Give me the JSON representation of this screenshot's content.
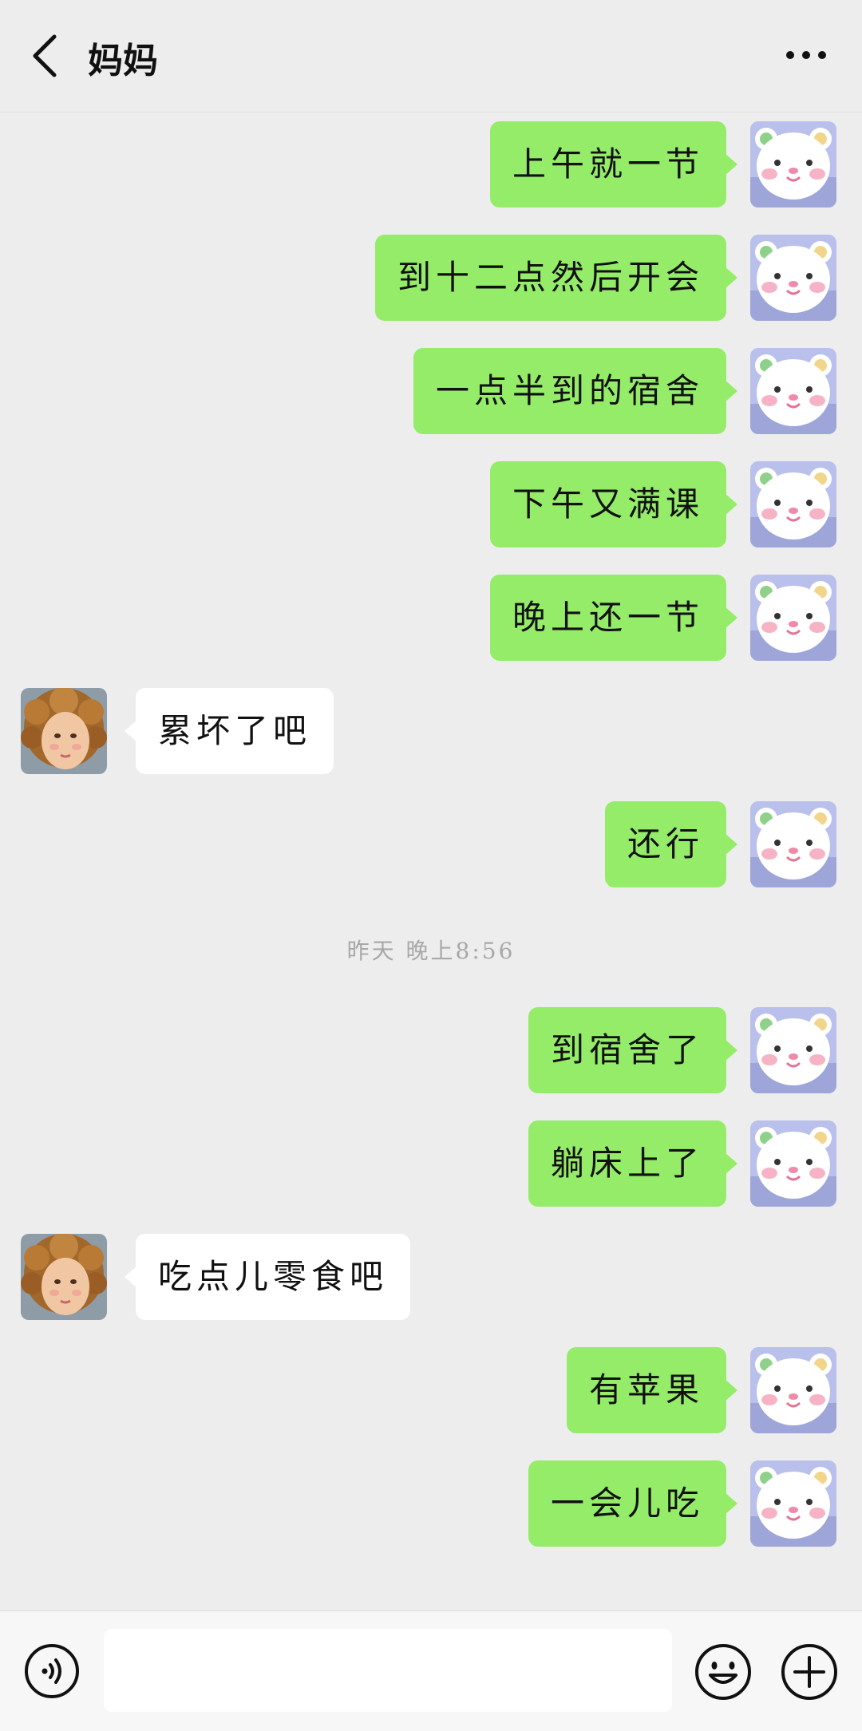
{
  "header": {
    "title": "妈妈",
    "back_icon": "chevron-left-icon",
    "more_icon": "more-dots-icon"
  },
  "messages": [
    {
      "side": "self",
      "text": "上午就一节"
    },
    {
      "side": "self",
      "text": "到十二点然后开会"
    },
    {
      "side": "self",
      "text": "一点半到的宿舍"
    },
    {
      "side": "self",
      "text": "下午又满课"
    },
    {
      "side": "self",
      "text": "晚上还一节"
    },
    {
      "side": "other",
      "text": "累坏了吧"
    },
    {
      "side": "self",
      "text": "还行"
    },
    {
      "side": "self",
      "text": "到宿舍了"
    },
    {
      "side": "self",
      "text": "躺床上了"
    },
    {
      "side": "other",
      "text": "吃点儿零食吧"
    },
    {
      "side": "self",
      "text": "有苹果"
    },
    {
      "side": "self",
      "text": "一会儿吃"
    }
  ],
  "timestamp": "昨天 晚上8:56",
  "input_bar": {
    "voice_icon": "voice-icon",
    "input_value": "",
    "emoji_icon": "emoji-icon",
    "plus_icon": "plus-icon"
  },
  "colors": {
    "self_bubble": "#95ec69",
    "other_bubble": "#ffffff",
    "background": "#ededed"
  }
}
